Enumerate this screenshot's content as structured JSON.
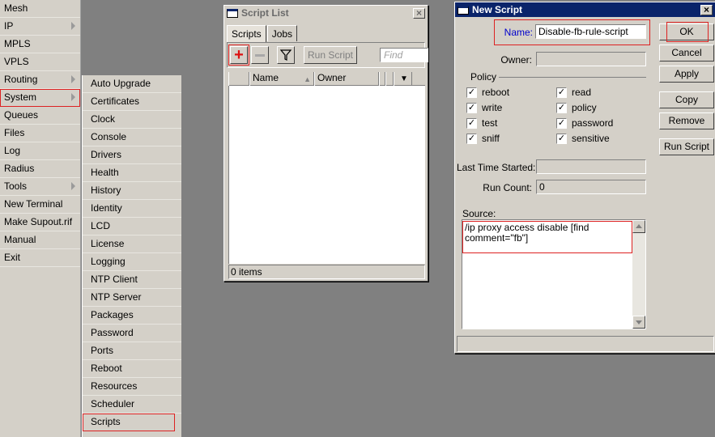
{
  "main_menu": {
    "items": [
      {
        "label": "Mesh",
        "arrow": false
      },
      {
        "label": "IP",
        "arrow": true
      },
      {
        "label": "MPLS",
        "arrow": false
      },
      {
        "label": "VPLS",
        "arrow": false
      },
      {
        "label": "Routing",
        "arrow": true
      },
      {
        "label": "System",
        "arrow": true,
        "highlighted": true
      },
      {
        "label": "Queues",
        "arrow": false
      },
      {
        "label": "Files",
        "arrow": false
      },
      {
        "label": "Log",
        "arrow": false
      },
      {
        "label": "Radius",
        "arrow": false
      },
      {
        "label": "Tools",
        "arrow": true
      },
      {
        "label": "New Terminal",
        "arrow": false
      },
      {
        "label": "Make Supout.rif",
        "arrow": false
      },
      {
        "label": "Manual",
        "arrow": false
      },
      {
        "label": "Exit",
        "arrow": false
      }
    ]
  },
  "system_submenu": {
    "items": [
      "Auto Upgrade",
      "Certificates",
      "Clock",
      "Console",
      "Drivers",
      "Health",
      "History",
      "Identity",
      "LCD",
      "License",
      "Logging",
      "NTP Client",
      "NTP Server",
      "Packages",
      "Password",
      "Ports",
      "Reboot",
      "Resources",
      "Scheduler",
      "Scripts"
    ],
    "highlighted": "Scripts"
  },
  "script_list": {
    "title": "Script List",
    "tabs": [
      "Scripts",
      "Jobs"
    ],
    "run_script_label": "Run Script",
    "find_placeholder": "Find",
    "columns": [
      "Name",
      "Owner"
    ],
    "status": "0 items"
  },
  "new_script": {
    "title": "New Script",
    "name_label": "Name:",
    "name_value": "Disable-fb-rule-script",
    "owner_label": "Owner:",
    "owner_value": "",
    "policy_label": "Policy",
    "policies": [
      {
        "label": "reboot",
        "checked": true
      },
      {
        "label": "read",
        "checked": true
      },
      {
        "label": "write",
        "checked": true
      },
      {
        "label": "policy",
        "checked": true
      },
      {
        "label": "test",
        "checked": true
      },
      {
        "label": "password",
        "checked": true
      },
      {
        "label": "sniff",
        "checked": true
      },
      {
        "label": "sensitive",
        "checked": true
      }
    ],
    "last_time_started_label": "Last Time Started:",
    "last_time_started_value": "",
    "run_count_label": "Run Count:",
    "run_count_value": "0",
    "source_label": "Source:",
    "source_line1": "/ip proxy access disable [find",
    "source_line2": "comment=\"fb\"]",
    "buttons": {
      "ok": "OK",
      "cancel": "Cancel",
      "apply": "Apply",
      "copy": "Copy",
      "remove": "Remove",
      "run_script": "Run Script"
    }
  },
  "colors": {
    "desktop": "#808080",
    "window_face": "#d4d0c8",
    "active_title": "#0a246a",
    "highlight": "#dd2222",
    "name_label": "#0000cc"
  }
}
